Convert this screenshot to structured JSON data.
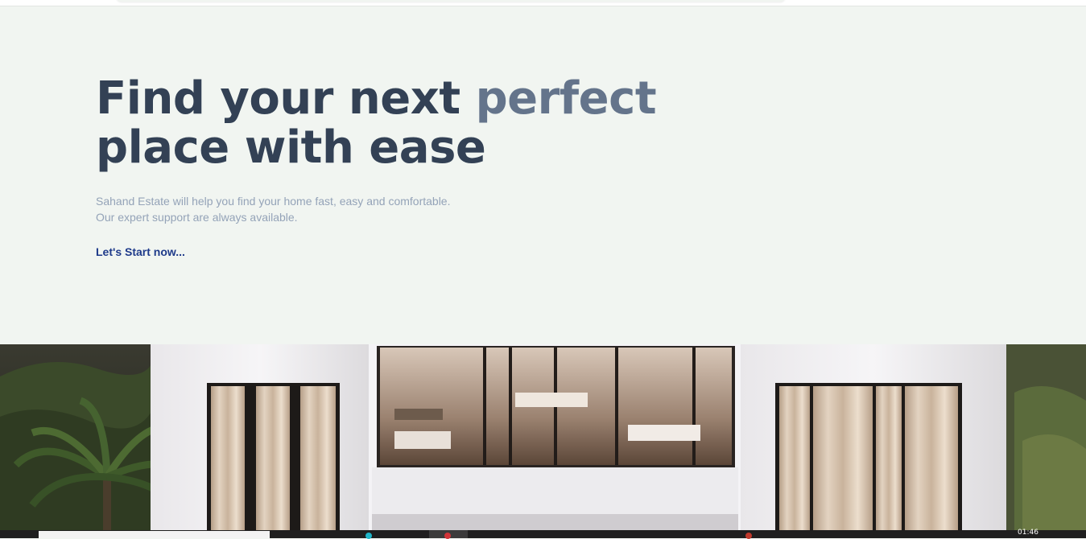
{
  "hero": {
    "headline_part1": "Find your next ",
    "headline_accent": "perfect",
    "headline_part2": "place with ease",
    "subtext_line1": "Sahand Estate will help you find your home fast, easy and comfortable.",
    "subtext_line2": "Our expert support are always available.",
    "cta_label": "Let's Start now..."
  },
  "colors": {
    "background": "#f1f5f1",
    "headline": "#334155",
    "headline_accent": "#64748b",
    "subtext": "#94a3b8",
    "cta": "#1e3a8a"
  },
  "image": {
    "subject": "modern white two-story house at dusk with palm tree"
  },
  "taskbar": {
    "clock": "01:46"
  }
}
